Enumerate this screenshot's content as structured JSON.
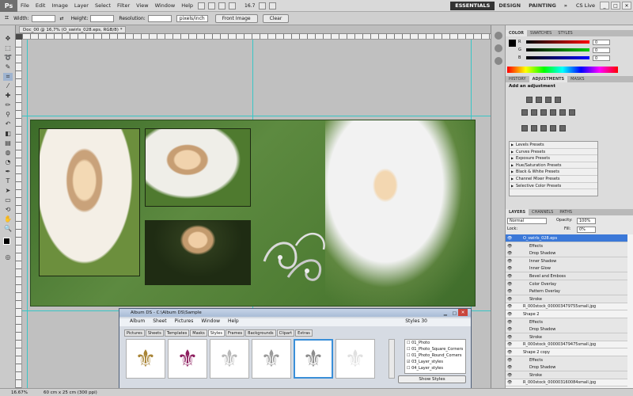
{
  "app": {
    "logo": "Ps"
  },
  "menubar": {
    "items": [
      "File",
      "Edit",
      "Image",
      "Layer",
      "Select",
      "Filter",
      "View",
      "Window",
      "Help"
    ],
    "zoom": "16.7",
    "workspaces": {
      "essentials": "ESSENTIALS",
      "design": "DESIGN",
      "painting": "PAINTING"
    },
    "cslive": "CS Live"
  },
  "options": {
    "width_label": "Width:",
    "height_label": "Height:",
    "resolution_label": "Resolution:",
    "res_unit": "pixels/inch",
    "front_image": "Front Image",
    "clear": "Clear"
  },
  "document": {
    "tab": "Doc_00 @ 16,7% (O_swirls_028.eps, RGB/8) *"
  },
  "status": {
    "zoom": "16.67%",
    "size": "60 cm x 25 cm (300 ppi)"
  },
  "color_panel": {
    "tabs": [
      "COLOR",
      "SWATCHES",
      "STYLES"
    ],
    "r": {
      "label": "R",
      "value": "0"
    },
    "g": {
      "label": "G",
      "value": "0"
    },
    "b": {
      "label": "B",
      "value": "0"
    }
  },
  "adjust_panel": {
    "tabs": [
      "HISTORY",
      "ADJUSTMENTS",
      "MASKS"
    ],
    "heading": "Add an adjustment",
    "presets": [
      "Levels Presets",
      "Curves Presets",
      "Exposure Presets",
      "Hue/Saturation Presets",
      "Black & White Presets",
      "Channel Mixer Presets",
      "Selective Color Presets"
    ]
  },
  "layers_panel": {
    "tabs": [
      "LAYERS",
      "CHANNELS",
      "PATHS"
    ],
    "blend": "Normal",
    "opacity_label": "Opacity:",
    "opacity": "100%",
    "lock_label": "Lock:",
    "fill_label": "Fill:",
    "fill": "0%",
    "rows": [
      {
        "name": "O_swirls_028.eps",
        "kind": "sel"
      },
      {
        "name": "Effects",
        "kind": "eff"
      },
      {
        "name": "Drop Shadow",
        "kind": "eff"
      },
      {
        "name": "Inner Shadow",
        "kind": "eff"
      },
      {
        "name": "Inner Glow",
        "kind": "eff"
      },
      {
        "name": "Bevel and Emboss",
        "kind": "eff"
      },
      {
        "name": "Color Overlay",
        "kind": "eff"
      },
      {
        "name": "Pattern Overlay",
        "kind": "eff"
      },
      {
        "name": "Stroke",
        "kind": "eff"
      },
      {
        "name": "R_000stock_000003479755small.jpg",
        "kind": "layer"
      },
      {
        "name": "Shape 2",
        "kind": "layer"
      },
      {
        "name": "Effects",
        "kind": "eff"
      },
      {
        "name": "Drop Shadow",
        "kind": "eff"
      },
      {
        "name": "Stroke",
        "kind": "eff"
      },
      {
        "name": "R_000stock_000003479475small.jpg",
        "kind": "layer"
      },
      {
        "name": "Shape 2 copy",
        "kind": "layer"
      },
      {
        "name": "Effects",
        "kind": "eff"
      },
      {
        "name": "Drop Shadow",
        "kind": "eff"
      },
      {
        "name": "Stroke",
        "kind": "eff"
      },
      {
        "name": "R_000stock_000003160084small.jpg",
        "kind": "layer"
      }
    ]
  },
  "album": {
    "title": "Album DS  -  C:\\Album DS\\Sample",
    "menu": [
      "Album",
      "Sheet",
      "Pictures",
      "Window",
      "Help"
    ],
    "styles_count": "Styles 30",
    "tabs": [
      "Pictures",
      "Sheets",
      "Templates",
      "Masks",
      "Styles",
      "Frames",
      "Backgrounds",
      "Clipart",
      "Extras"
    ],
    "active_tab": "Styles",
    "thumb_colors": [
      "#a88435",
      "#8d1d5e",
      "#b8b8b8",
      "#9a9a9a",
      "#8c8c8c",
      "#e0e0e0"
    ],
    "style_items": [
      "01_Photo",
      "01_Photo_Square_Corners",
      "01_Photo_Round_Corners",
      "03_Layer_styles",
      "04_Layer_styles"
    ],
    "show_styles": "Show Styles"
  }
}
